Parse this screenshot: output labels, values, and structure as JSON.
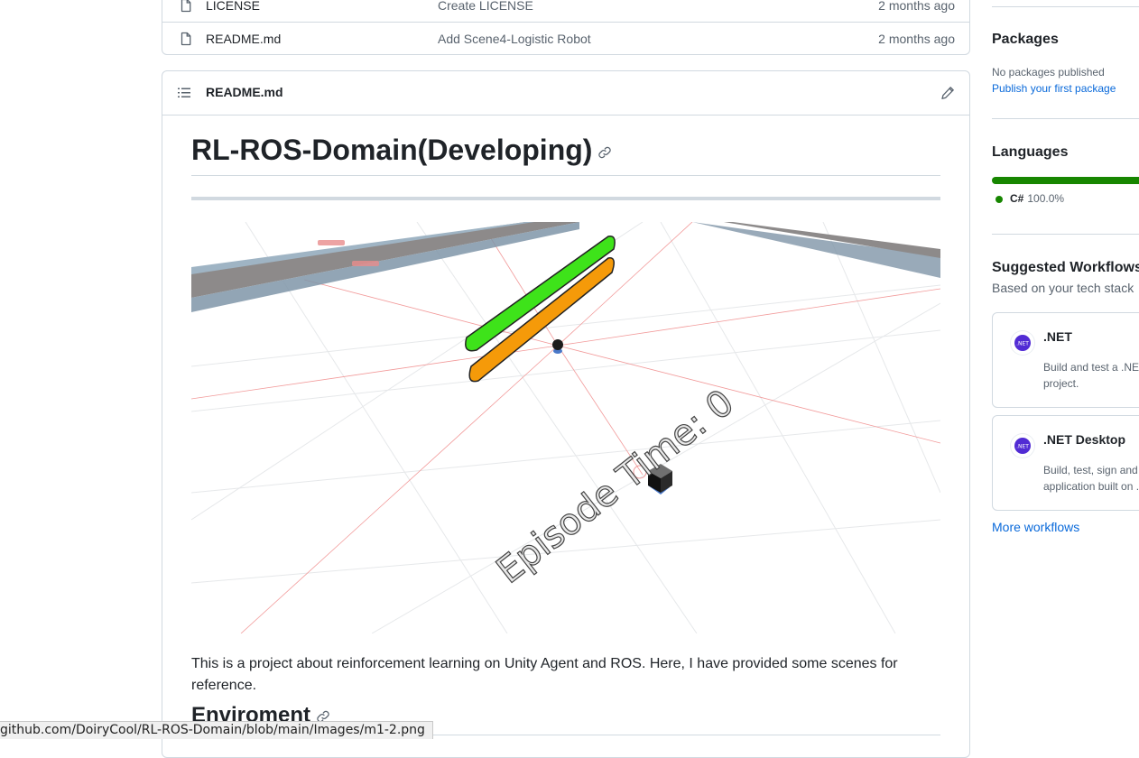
{
  "files": [
    {
      "name": "LICENSE",
      "message": "Create LICENSE",
      "date": "2 months ago"
    },
    {
      "name": "README.md",
      "message": "Add Scene4-Logistic Robot",
      "date": "2 months ago"
    }
  ],
  "readme": {
    "header_title": "README.md",
    "h1": "RL-ROS-Domain(Developing)",
    "paragraph": "This is a project about reinforcement learning on Unity Agent and ROS. Here, I have provided some scenes for reference.",
    "h2": "Enviroment",
    "scene_overlay_text": "Episode Time: 0"
  },
  "sidebar": {
    "packages": {
      "title": "Packages",
      "none_text": "No packages published",
      "publish_link": "Publish your first package"
    },
    "languages": {
      "title": "Languages",
      "items": [
        {
          "name": "C#",
          "percent": "100.0%",
          "color": "#178600",
          "fraction": 1.0
        }
      ]
    },
    "workflows": {
      "title": "Suggested Workflows",
      "subtitle": "Based on your tech stack",
      "cards": [
        {
          "name": ".NET",
          "description": "Build and test a .NET project.",
          "logo_text": ".NET"
        },
        {
          "name": ".NET Desktop",
          "description": "Build, test, sign and application built on .",
          "logo_text": ".NET"
        }
      ],
      "more_link": "More workflows"
    }
  },
  "status_url": "github.com/DoiryCool/RL-ROS-Domain/blob/main/Images/m1-2.png",
  "colors": {
    "accent": "#0969da",
    "csharp": "#178600",
    "dotnet": "#512bd4"
  },
  "icons": [
    "file-icon",
    "list-icon",
    "pencil-icon",
    "link-icon",
    "dotnet-logo-icon"
  ]
}
